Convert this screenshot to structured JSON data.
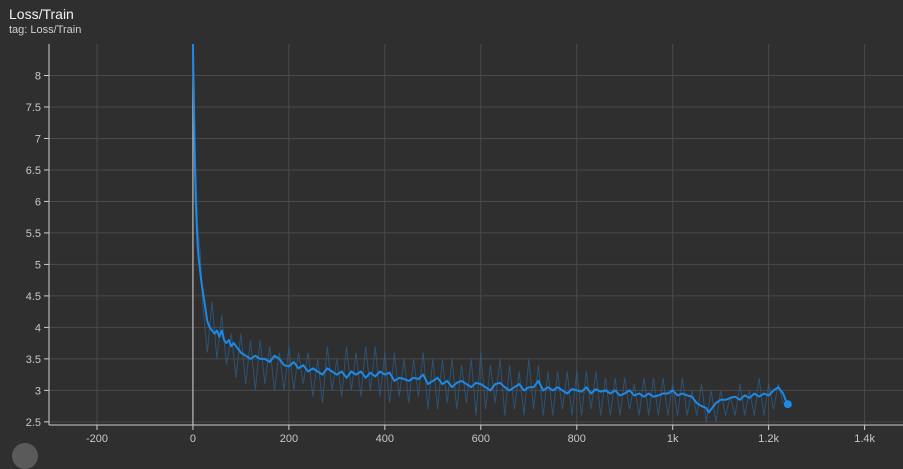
{
  "card": {
    "title": "Loss/Train",
    "tag": "tag: Loss/Train"
  },
  "colors": {
    "background": "#2f2f2f",
    "grid": "#4a4a4a",
    "axis": "#cfcfcf",
    "smoothed_line": "#1e88e5",
    "raw_line": "#2b5f8c",
    "zero_line": "#bdbdbd"
  },
  "chart_data": {
    "type": "line",
    "title": "Loss/Train",
    "xlabel": "",
    "ylabel": "",
    "xlim": [
      -300,
      1480
    ],
    "ylim": [
      2.45,
      8.5
    ],
    "grid": true,
    "x_ticks": [
      {
        "value": -200,
        "label": "-200"
      },
      {
        "value": 0,
        "label": "0"
      },
      {
        "value": 200,
        "label": "200"
      },
      {
        "value": 400,
        "label": "400"
      },
      {
        "value": 600,
        "label": "600"
      },
      {
        "value": 800,
        "label": "800"
      },
      {
        "value": 1000,
        "label": "1k"
      },
      {
        "value": 1200,
        "label": "1.2k"
      },
      {
        "value": 1400,
        "label": "1.4k"
      }
    ],
    "y_ticks": [
      {
        "value": 2.5,
        "label": "2.5"
      },
      {
        "value": 3,
        "label": "3"
      },
      {
        "value": 3.5,
        "label": "3.5"
      },
      {
        "value": 4,
        "label": "4"
      },
      {
        "value": 4.5,
        "label": "4.5"
      },
      {
        "value": 5,
        "label": "5"
      },
      {
        "value": 5.5,
        "label": "5.5"
      },
      {
        "value": 6,
        "label": "6"
      },
      {
        "value": 6.5,
        "label": "6.5"
      },
      {
        "value": 7,
        "label": "7"
      },
      {
        "value": 7.5,
        "label": "7.5"
      },
      {
        "value": 8,
        "label": "8"
      }
    ],
    "series": [
      {
        "role": "raw",
        "x": [
          0,
          5,
          10,
          15,
          20,
          30,
          40,
          50,
          60,
          70,
          80,
          90,
          100,
          110,
          120,
          130,
          140,
          150,
          160,
          170,
          180,
          190,
          200,
          210,
          220,
          230,
          240,
          250,
          260,
          270,
          280,
          290,
          300,
          310,
          320,
          330,
          340,
          350,
          360,
          370,
          380,
          390,
          400,
          410,
          420,
          430,
          440,
          450,
          460,
          470,
          480,
          490,
          500,
          510,
          520,
          530,
          540,
          550,
          560,
          570,
          580,
          590,
          600,
          610,
          620,
          630,
          640,
          650,
          660,
          670,
          680,
          690,
          700,
          710,
          720,
          730,
          740,
          750,
          760,
          770,
          780,
          790,
          800,
          810,
          820,
          830,
          840,
          850,
          860,
          870,
          880,
          890,
          900,
          910,
          920,
          930,
          940,
          950,
          960,
          970,
          980,
          990,
          1000,
          1010,
          1020,
          1030,
          1040,
          1050,
          1060,
          1070,
          1080,
          1090,
          1100,
          1110,
          1120,
          1130,
          1140,
          1150,
          1160,
          1170,
          1180,
          1190,
          1200,
          1210,
          1220,
          1230,
          1240
        ],
        "y": [
          8.5,
          6.8,
          5.6,
          5.2,
          4.4,
          3.6,
          4.4,
          3.5,
          4.2,
          3.4,
          3.9,
          3.2,
          3.9,
          3.1,
          3.8,
          3.0,
          3.8,
          3.1,
          3.7,
          3.0,
          3.6,
          3.0,
          3.7,
          3.0,
          3.6,
          3.1,
          3.6,
          2.9,
          3.5,
          2.8,
          3.7,
          3.0,
          3.5,
          2.9,
          3.7,
          3.0,
          3.6,
          2.9,
          3.7,
          3.0,
          3.7,
          2.9,
          3.6,
          2.8,
          3.6,
          2.9,
          3.5,
          2.8,
          3.5,
          2.9,
          3.6,
          2.7,
          3.5,
          2.7,
          3.5,
          2.8,
          3.5,
          2.7,
          3.4,
          2.8,
          3.5,
          2.6,
          3.6,
          2.7,
          3.4,
          2.8,
          3.5,
          2.6,
          3.4,
          2.7,
          3.3,
          2.6,
          3.5,
          2.7,
          3.4,
          2.6,
          3.3,
          2.6,
          3.3,
          2.7,
          3.3,
          2.6,
          3.3,
          2.6,
          3.3,
          2.7,
          3.3,
          2.6,
          3.2,
          2.6,
          3.2,
          2.6,
          3.2,
          2.7,
          3.1,
          2.6,
          3.2,
          2.6,
          3.2,
          2.6,
          3.2,
          2.6,
          3.1,
          2.6,
          3.2,
          2.6,
          3.0,
          2.6,
          3.1,
          2.5,
          3.0,
          2.5,
          3.0,
          2.6,
          2.9,
          2.6,
          3.1,
          2.6,
          3.0,
          2.6,
          3.2,
          2.6,
          3.1,
          2.7,
          3.1,
          2.8,
          2.8
        ]
      },
      {
        "role": "smoothed",
        "x": [
          0,
          2,
          4,
          6,
          8,
          10,
          12,
          15,
          18,
          22,
          26,
          30,
          35,
          40,
          45,
          50,
          55,
          60,
          65,
          70,
          75,
          80,
          85,
          90,
          95,
          100,
          110,
          120,
          130,
          140,
          150,
          160,
          170,
          180,
          190,
          200,
          210,
          220,
          230,
          240,
          250,
          260,
          270,
          280,
          290,
          300,
          310,
          320,
          330,
          340,
          350,
          360,
          370,
          380,
          390,
          400,
          410,
          420,
          430,
          440,
          450,
          460,
          470,
          480,
          490,
          500,
          510,
          520,
          530,
          540,
          550,
          560,
          570,
          580,
          590,
          600,
          610,
          620,
          630,
          640,
          650,
          660,
          670,
          680,
          690,
          700,
          710,
          720,
          730,
          740,
          750,
          760,
          770,
          780,
          790,
          800,
          810,
          820,
          830,
          840,
          850,
          860,
          870,
          880,
          890,
          900,
          910,
          920,
          930,
          940,
          950,
          960,
          970,
          980,
          990,
          1000,
          1010,
          1020,
          1030,
          1040,
          1050,
          1060,
          1070,
          1075,
          1080,
          1085,
          1090,
          1100,
          1110,
          1120,
          1130,
          1140,
          1150,
          1160,
          1170,
          1180,
          1190,
          1200,
          1210,
          1220,
          1225,
          1230,
          1235,
          1240
        ],
        "y": [
          8.5,
          7.6,
          6.6,
          6.0,
          5.6,
          5.3,
          5.1,
          4.9,
          4.7,
          4.5,
          4.3,
          4.1,
          4.0,
          3.95,
          3.9,
          3.95,
          3.85,
          3.95,
          3.8,
          3.75,
          3.8,
          3.7,
          3.75,
          3.7,
          3.65,
          3.6,
          3.55,
          3.5,
          3.55,
          3.5,
          3.5,
          3.45,
          3.55,
          3.5,
          3.4,
          3.38,
          3.45,
          3.35,
          3.4,
          3.3,
          3.35,
          3.3,
          3.25,
          3.35,
          3.3,
          3.25,
          3.3,
          3.2,
          3.3,
          3.25,
          3.3,
          3.2,
          3.28,
          3.22,
          3.3,
          3.25,
          3.28,
          3.15,
          3.2,
          3.18,
          3.15,
          3.2,
          3.18,
          3.25,
          3.1,
          3.15,
          3.2,
          3.1,
          3.15,
          3.05,
          3.12,
          3.15,
          3.1,
          3.05,
          3.12,
          3.1,
          3.05,
          3.0,
          3.1,
          3.12,
          3.05,
          3.0,
          3.05,
          3.1,
          3.0,
          3.05,
          3.05,
          3.15,
          3.0,
          3.05,
          3.0,
          3.05,
          3.0,
          2.95,
          3.02,
          3.0,
          2.98,
          3.05,
          2.95,
          3.02,
          2.98,
          3.0,
          2.95,
          3.0,
          2.92,
          2.95,
          3.0,
          2.92,
          2.95,
          2.9,
          2.95,
          2.9,
          2.92,
          2.95,
          2.95,
          3.0,
          2.92,
          2.95,
          2.92,
          2.9,
          2.8,
          2.75,
          2.72,
          2.65,
          2.7,
          2.75,
          2.8,
          2.85,
          2.85,
          2.88,
          2.9,
          2.85,
          2.92,
          2.88,
          2.95,
          2.9,
          2.95,
          2.92,
          3.0,
          3.05,
          3.0,
          2.95,
          2.85,
          2.78
        ]
      }
    ],
    "last_point": {
      "x": 1240,
      "y": 2.78
    }
  }
}
